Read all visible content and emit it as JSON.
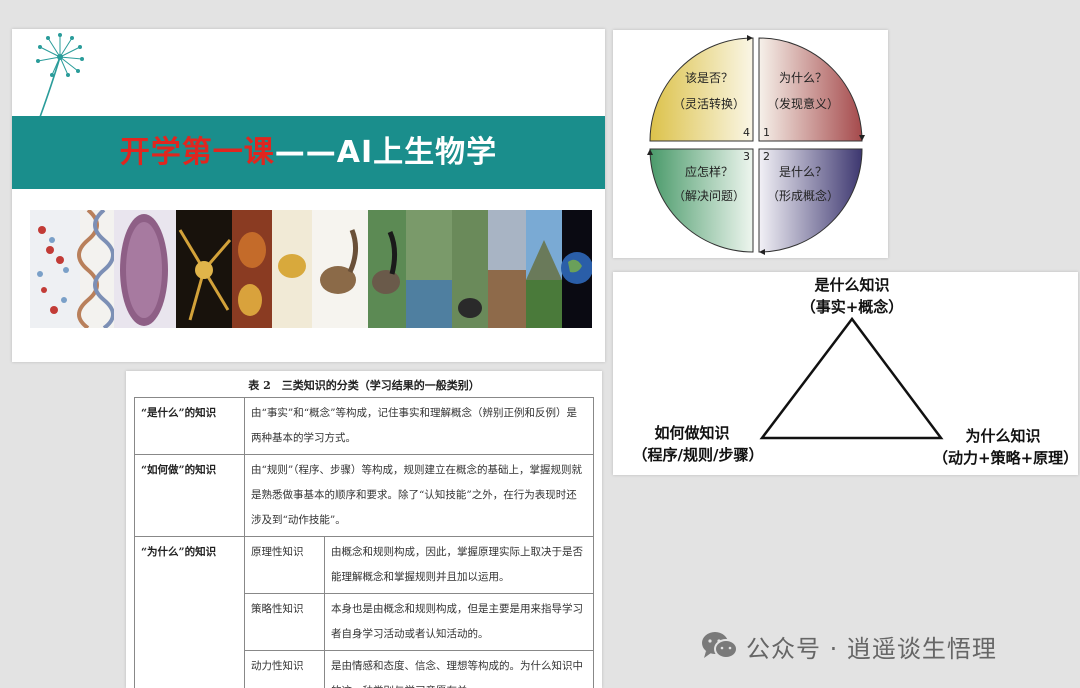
{
  "slide": {
    "title_part1": "开学第一课",
    "title_part2": "——AI上生物学"
  },
  "quadrant": {
    "q1": {
      "q": "为什么？",
      "a": "（发现意义）",
      "n": "1"
    },
    "q2": {
      "q": "是什么？",
      "a": "（形成概念）",
      "n": "2"
    },
    "q3": {
      "q": "应怎样？",
      "a": "（解决问题）",
      "n": "3"
    },
    "q4": {
      "q": "该是否？",
      "a": "（灵活转换）",
      "n": "4"
    },
    "colors": {
      "q1": "#a54a4c",
      "q2": "#3d3770",
      "q3": "#4a9a6a",
      "q4": "#dcc24a"
    }
  },
  "triangle": {
    "top": {
      "title": "是什么知识",
      "sub": "（事实+概念）"
    },
    "left": {
      "title": "如何做知识",
      "sub": "（程序/规则/步骤）"
    },
    "right": {
      "title": "为什么知识",
      "sub": "（动力+策略+原理）"
    }
  },
  "table": {
    "caption": "表 2　三类知识的分类（学习结果的一般类别）",
    "rows": [
      {
        "head": "“是什么”的知识",
        "text": "由“事实”和“概念”等构成，记住事实和理解概念（辨别正例和反例）是两种基本的学习方式。"
      },
      {
        "head": "“如何做”的知识",
        "text": "由“规则”（程序、步骤）等构成，规则建立在概念的基础上，掌握规则就是熟悉做事基本的顺序和要求。除了“认知技能”之外，在行为表现时还涉及到“动作技能”。"
      },
      {
        "head": "“为什么”的知识",
        "subs": [
          {
            "name": "原理性知识",
            "text": "由概念和规则构成，因此，掌握原理实际上取决于是否能理解概念和掌握规则并且加以运用。"
          },
          {
            "name": "策略性知识",
            "text": "本身也是由概念和规则构成，但是主要是用来指导学习者自身学习活动或者认知活动的。"
          },
          {
            "name": "动力性知识",
            "text": "是由情感和态度、信念、理想等构成的。为什么知识中的这一种类别与学习意愿有关。"
          }
        ]
      }
    ]
  },
  "watermark": {
    "text": "公众号 · 逍遥谈生悟理"
  }
}
